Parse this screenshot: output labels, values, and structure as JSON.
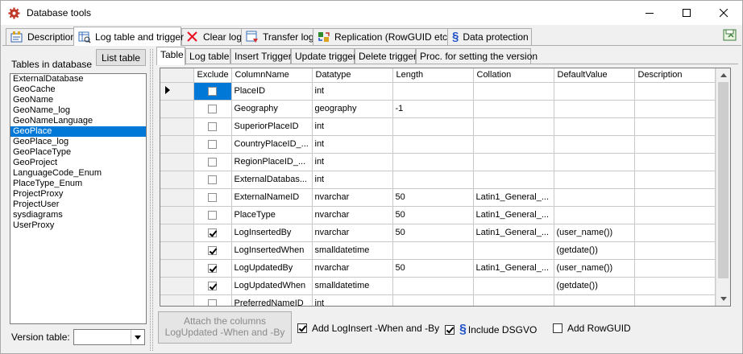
{
  "window": {
    "title": "Database tools"
  },
  "main_tabs": [
    {
      "label": "Description",
      "icon": "description-icon"
    },
    {
      "label": "Log table and trigger",
      "icon": "log-table-icon"
    },
    {
      "label": "Clear log",
      "icon": "clear-log-x-icon"
    },
    {
      "label": "Transfer log",
      "icon": "transfer-log-icon"
    },
    {
      "label": "Replication (RowGUID etc.)",
      "icon": "replication-icon"
    },
    {
      "label": "Data protection",
      "icon": "paragraph-icon"
    }
  ],
  "left": {
    "label": "Tables in database",
    "list_button": "List table",
    "tables": [
      "ExternalDatabase",
      "GeoCache",
      "GeoName",
      "GeoName_log",
      "GeoNameLanguage",
      "GeoPlace",
      "GeoPlace_log",
      "GeoPlaceType",
      "GeoProject",
      "LanguageCode_Enum",
      "PlaceType_Enum",
      "ProjectProxy",
      "ProjectUser",
      "sysdiagrams",
      "UserProxy"
    ],
    "selected": "GeoPlace",
    "version_label": "Version table:",
    "version_value": ""
  },
  "inner_tabs": [
    "Table",
    "Log table",
    "Insert Trigger",
    "Update trigger",
    "Delete trigger",
    "Proc. for setting the version"
  ],
  "grid": {
    "columns": [
      "Exclude",
      "ColumnName",
      "Datatype",
      "Length",
      "Collation",
      "DefaultValue",
      "Description"
    ],
    "rows": [
      {
        "exclude": false,
        "name": "PlaceID",
        "type": "int",
        "length": "",
        "collation": "",
        "default": "",
        "desc": ""
      },
      {
        "exclude": false,
        "name": "Geography",
        "type": "geography",
        "length": "-1",
        "collation": "",
        "default": "",
        "desc": ""
      },
      {
        "exclude": false,
        "name": "SuperiorPlaceID",
        "type": "int",
        "length": "",
        "collation": "",
        "default": "",
        "desc": ""
      },
      {
        "exclude": false,
        "name": "CountryPlaceID_...",
        "type": "int",
        "length": "",
        "collation": "",
        "default": "",
        "desc": ""
      },
      {
        "exclude": false,
        "name": "RegionPlaceID_...",
        "type": "int",
        "length": "",
        "collation": "",
        "default": "",
        "desc": ""
      },
      {
        "exclude": false,
        "name": "ExternalDatabas...",
        "type": "int",
        "length": "",
        "collation": "",
        "default": "",
        "desc": ""
      },
      {
        "exclude": false,
        "name": "ExternalNameID",
        "type": "nvarchar",
        "length": "50",
        "collation": "Latin1_General_...",
        "default": "",
        "desc": ""
      },
      {
        "exclude": false,
        "name": "PlaceType",
        "type": "nvarchar",
        "length": "50",
        "collation": "Latin1_General_...",
        "default": "",
        "desc": ""
      },
      {
        "exclude": true,
        "name": "LogInsertedBy",
        "type": "nvarchar",
        "length": "50",
        "collation": "Latin1_General_...",
        "default": "(user_name())",
        "desc": ""
      },
      {
        "exclude": true,
        "name": "LogInsertedWhen",
        "type": "smalldatetime",
        "length": "",
        "collation": "",
        "default": "(getdate())",
        "desc": ""
      },
      {
        "exclude": true,
        "name": "LogUpdatedBy",
        "type": "nvarchar",
        "length": "50",
        "collation": "Latin1_General_...",
        "default": "(user_name())",
        "desc": ""
      },
      {
        "exclude": true,
        "name": "LogUpdatedWhen",
        "type": "smalldatetime",
        "length": "",
        "collation": "",
        "default": "(getdate())",
        "desc": ""
      },
      {
        "exclude": false,
        "name": "PreferredNameID",
        "type": "int",
        "length": "",
        "collation": "",
        "default": "",
        "desc": ""
      }
    ]
  },
  "bottom": {
    "attach_line1": "Attach the columns",
    "attach_line2": "LogUpdated -When and -By",
    "opt_loginsert": "Add LogInsert -When and -By",
    "opt_loginsert_checked": true,
    "opt_dsgvo": "Include DSGVO",
    "opt_dsgvo_checked": true,
    "opt_rowguid": "Add RowGUID",
    "opt_rowguid_checked": false
  },
  "colors": {
    "selection": "#0078d7",
    "red_x": "#e81123",
    "paragraph_blue": "#1e50c8"
  }
}
